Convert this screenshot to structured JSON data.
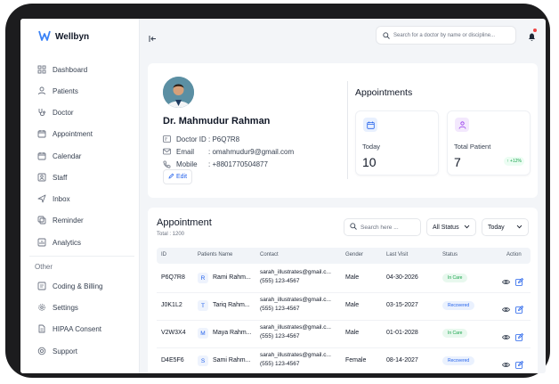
{
  "app": {
    "name": "Wellbyn",
    "accent": "#2563eb"
  },
  "sidebar": {
    "items": [
      {
        "label": "Dashboard",
        "icon": "grid-icon"
      },
      {
        "label": "Patients",
        "icon": "users-icon"
      },
      {
        "label": "Doctor",
        "icon": "stethoscope-icon"
      },
      {
        "label": "Appointment",
        "icon": "calendar-check-icon"
      },
      {
        "label": "Calendar",
        "icon": "calendar-icon"
      },
      {
        "label": "Staff",
        "icon": "id-card-icon"
      },
      {
        "label": "Inbox",
        "icon": "send-icon"
      },
      {
        "label": "Reminder",
        "icon": "reminder-icon"
      },
      {
        "label": "Analytics",
        "icon": "chart-icon"
      }
    ],
    "other_label": "Other",
    "other_items": [
      {
        "label": "Coding & Billing",
        "icon": "billing-icon"
      },
      {
        "label": "Settings",
        "icon": "gear-icon"
      },
      {
        "label": "HIPAA Consent",
        "icon": "document-icon"
      },
      {
        "label": "Support",
        "icon": "support-icon"
      }
    ]
  },
  "topbar": {
    "search_placeholder": "Search for a doctor by name or discipline..."
  },
  "profile": {
    "name": "Dr. Mahmudur Rahman",
    "doctor_id_label": "Doctor ID",
    "doctor_id": ": P6Q7R8",
    "email_label": "Email",
    "email": ": omahmudur9@gmail.com",
    "mobile_label": "Mobile",
    "mobile": ": +8801770504877",
    "edit_label": "Edit"
  },
  "appointments_summary": {
    "title": "Appointments",
    "today_label": "Today",
    "today_value": "10",
    "total_label": "Total Patient",
    "total_value": "7",
    "total_change": "↑ +12%"
  },
  "table": {
    "title": "Appointment",
    "total": "Total : 1200",
    "search_placeholder": "Search here ...",
    "status_filter": "All Status",
    "date_filter": "Today",
    "headers": [
      "ID",
      "Patients Name",
      "Contact",
      "Gender",
      "Last Visit",
      "Status",
      "Action"
    ],
    "rows": [
      {
        "id": "P6Q7R8",
        "initial": "R",
        "name": "Rami Rahm...",
        "email": "sarah_illustrates@gmail.c...",
        "phone": "(555) 123-4567",
        "gender": "Male",
        "last_visit": "04-30-2026",
        "status": "In Care"
      },
      {
        "id": "J0K1L2",
        "initial": "T",
        "name": "Tariq Rahm...",
        "email": "sarah_illustrates@gmail.c...",
        "phone": "(555) 123-4567",
        "gender": "Male",
        "last_visit": "03-15-2027",
        "status": "Recovered"
      },
      {
        "id": "V2W3X4",
        "initial": "M",
        "name": "Maya Rahm...",
        "email": "sarah_illustrates@gmail.c...",
        "phone": "(555) 123-4567",
        "gender": "Male",
        "last_visit": "01-01-2028",
        "status": "In Care"
      },
      {
        "id": "D4E5F6",
        "initial": "S",
        "name": "Sami Rahm...",
        "email": "sarah_illustrates@gmail.c...",
        "phone": "(555) 123-4567",
        "gender": "Female",
        "last_visit": "08-14-2027",
        "status": "Recovered"
      }
    ]
  }
}
